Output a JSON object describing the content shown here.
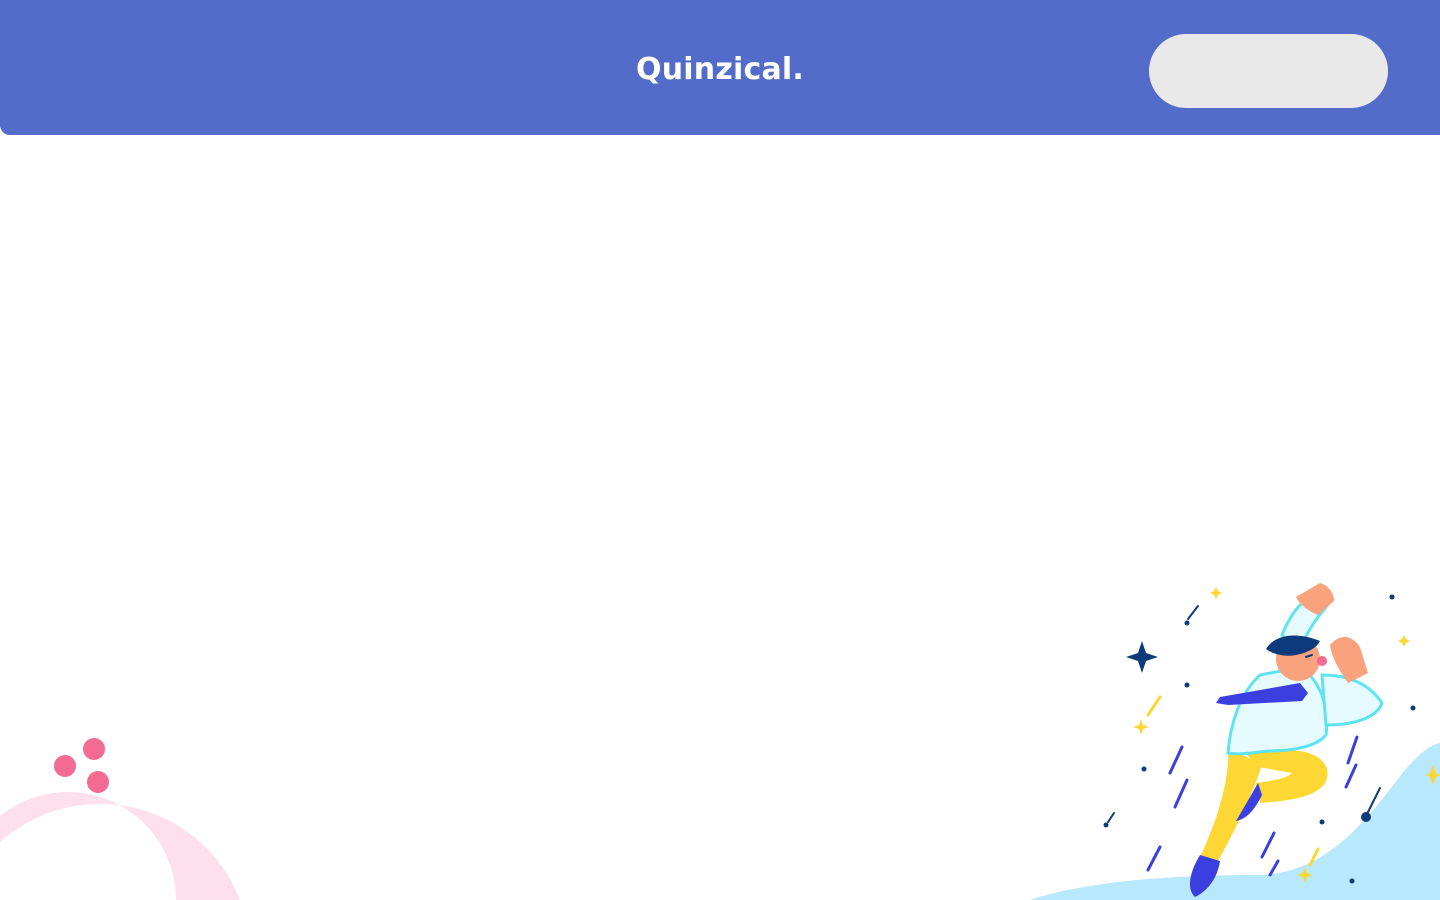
{
  "header": {
    "brand": "Quinzical.",
    "pill_button_label": ""
  },
  "colors": {
    "header_bg": "#536cc9",
    "page_bg": "#ffffff",
    "pill_bg": "#e9e9e9",
    "arc_pink": "#fde0ec",
    "dot_pink": "#f36b93",
    "wave_blue": "#b8e8fb",
    "accent_yellow": "#fdd835",
    "accent_navy": "#0d3a7a",
    "accent_blue": "#3b3fe0"
  },
  "decorations": {
    "left_icon": "pink-arc-dots",
    "right_icon": "jumping-person-illustration"
  }
}
